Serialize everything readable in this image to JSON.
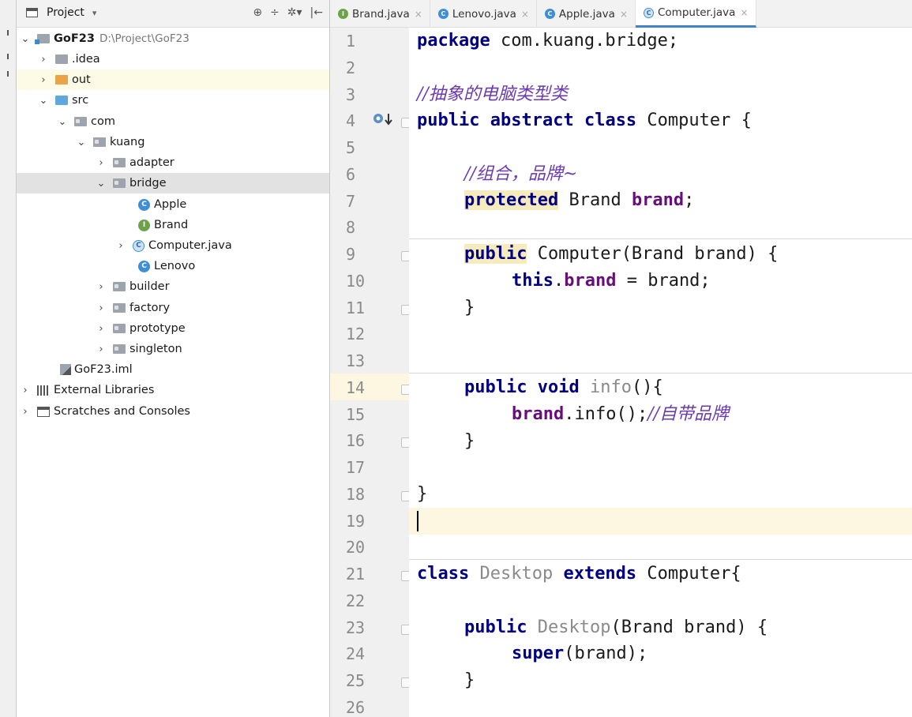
{
  "project_panel": {
    "title": "Project",
    "dropdown_glyph": "▾",
    "toolbar": [
      "⊕",
      "÷",
      "✲▾",
      "|←"
    ]
  },
  "tree": [
    {
      "label": "GoF23",
      "path": "D:\\Project\\GoF23",
      "icon": "module-folder-icon",
      "expand": "⌄"
    },
    {
      "label": ".idea",
      "icon": "folder-icon",
      "expand": "›"
    },
    {
      "label": "out",
      "icon": "folder-orange-icon",
      "expand": "›"
    },
    {
      "label": "src",
      "icon": "source-folder-icon",
      "expand": "⌄"
    },
    {
      "label": "com",
      "icon": "package-icon",
      "expand": "⌄"
    },
    {
      "label": "kuang",
      "icon": "package-icon",
      "expand": "⌄"
    },
    {
      "label": "adapter",
      "icon": "package-icon",
      "expand": "›"
    },
    {
      "label": "bridge",
      "icon": "package-icon",
      "expand": "⌄"
    },
    {
      "label": "Apple",
      "icon": "class-icon",
      "badge": "C"
    },
    {
      "label": "Brand",
      "icon": "interface-icon",
      "badge": "I"
    },
    {
      "label": "Computer.java",
      "icon": "abstract-class-icon",
      "badge": "C",
      "expand": "›"
    },
    {
      "label": "Lenovo",
      "icon": "class-icon",
      "badge": "C"
    },
    {
      "label": "builder",
      "icon": "package-icon",
      "expand": "›"
    },
    {
      "label": "factory",
      "icon": "package-icon",
      "expand": "›"
    },
    {
      "label": "prototype",
      "icon": "package-icon",
      "expand": "›"
    },
    {
      "label": "singleton",
      "icon": "package-icon",
      "expand": "›"
    },
    {
      "label": "GoF23.iml",
      "icon": "iml-file-icon"
    },
    {
      "label": "External Libraries",
      "icon": "library-icon",
      "expand": "›"
    },
    {
      "label": "Scratches and Consoles",
      "icon": "scratches-icon",
      "expand": "›"
    }
  ],
  "tabs": [
    {
      "label": "Brand.java",
      "badge": "I",
      "close": "×"
    },
    {
      "label": "Lenovo.java",
      "badge": "C",
      "close": "×"
    },
    {
      "label": "Apple.java",
      "badge": "C",
      "close": "×"
    },
    {
      "label": "Computer.java",
      "badge": "C",
      "close": "×",
      "active": true
    }
  ],
  "editor": {
    "line_numbers": [
      "1",
      "2",
      "3",
      "4",
      "5",
      "6",
      "7",
      "8",
      "9",
      "10",
      "11",
      "12",
      "13",
      "14",
      "15",
      "16",
      "17",
      "18",
      "19",
      "20",
      "21",
      "22",
      "23",
      "24",
      "25",
      "26"
    ],
    "code": {
      "l1_kw": "package",
      "l1_rest": " com.kuang.bridge;",
      "l3_comment": "//抽象的电脑类型类",
      "l4_kw1": "public",
      "l4_kw2": "abstract",
      "l4_kw3": "class",
      "l4_rest": " Computer {",
      "l6_comment": "//组合，品牌~",
      "l7_kw": "protected",
      "l7_type": " Brand ",
      "l7_field": "brand",
      "l7_end": ";",
      "l9_kw": "public",
      "l9_rest": " Computer(Brand brand) {",
      "l10_kw": "this",
      "l10_dot": ".",
      "l10_field": "brand",
      "l10_rest": " = brand;",
      "l11": "}",
      "l14_kw1": "public",
      "l14_kw2": "void",
      "l14_name": "info",
      "l14_rest": "(){",
      "l15_field": "brand",
      "l15_rest": ".info();",
      "l15_comment": "//自带品牌",
      "l16": "}",
      "l18": "}",
      "l21_kw": "class",
      "l21_name": "Desktop",
      "l21_kw2": "extends",
      "l21_rest": " Computer{",
      "l23_kw": "public",
      "l23_name": "Desktop",
      "l23_rest": "(Brand brand) {",
      "l24_kw": "super",
      "l24_rest": "(brand);",
      "l25": "}"
    }
  }
}
